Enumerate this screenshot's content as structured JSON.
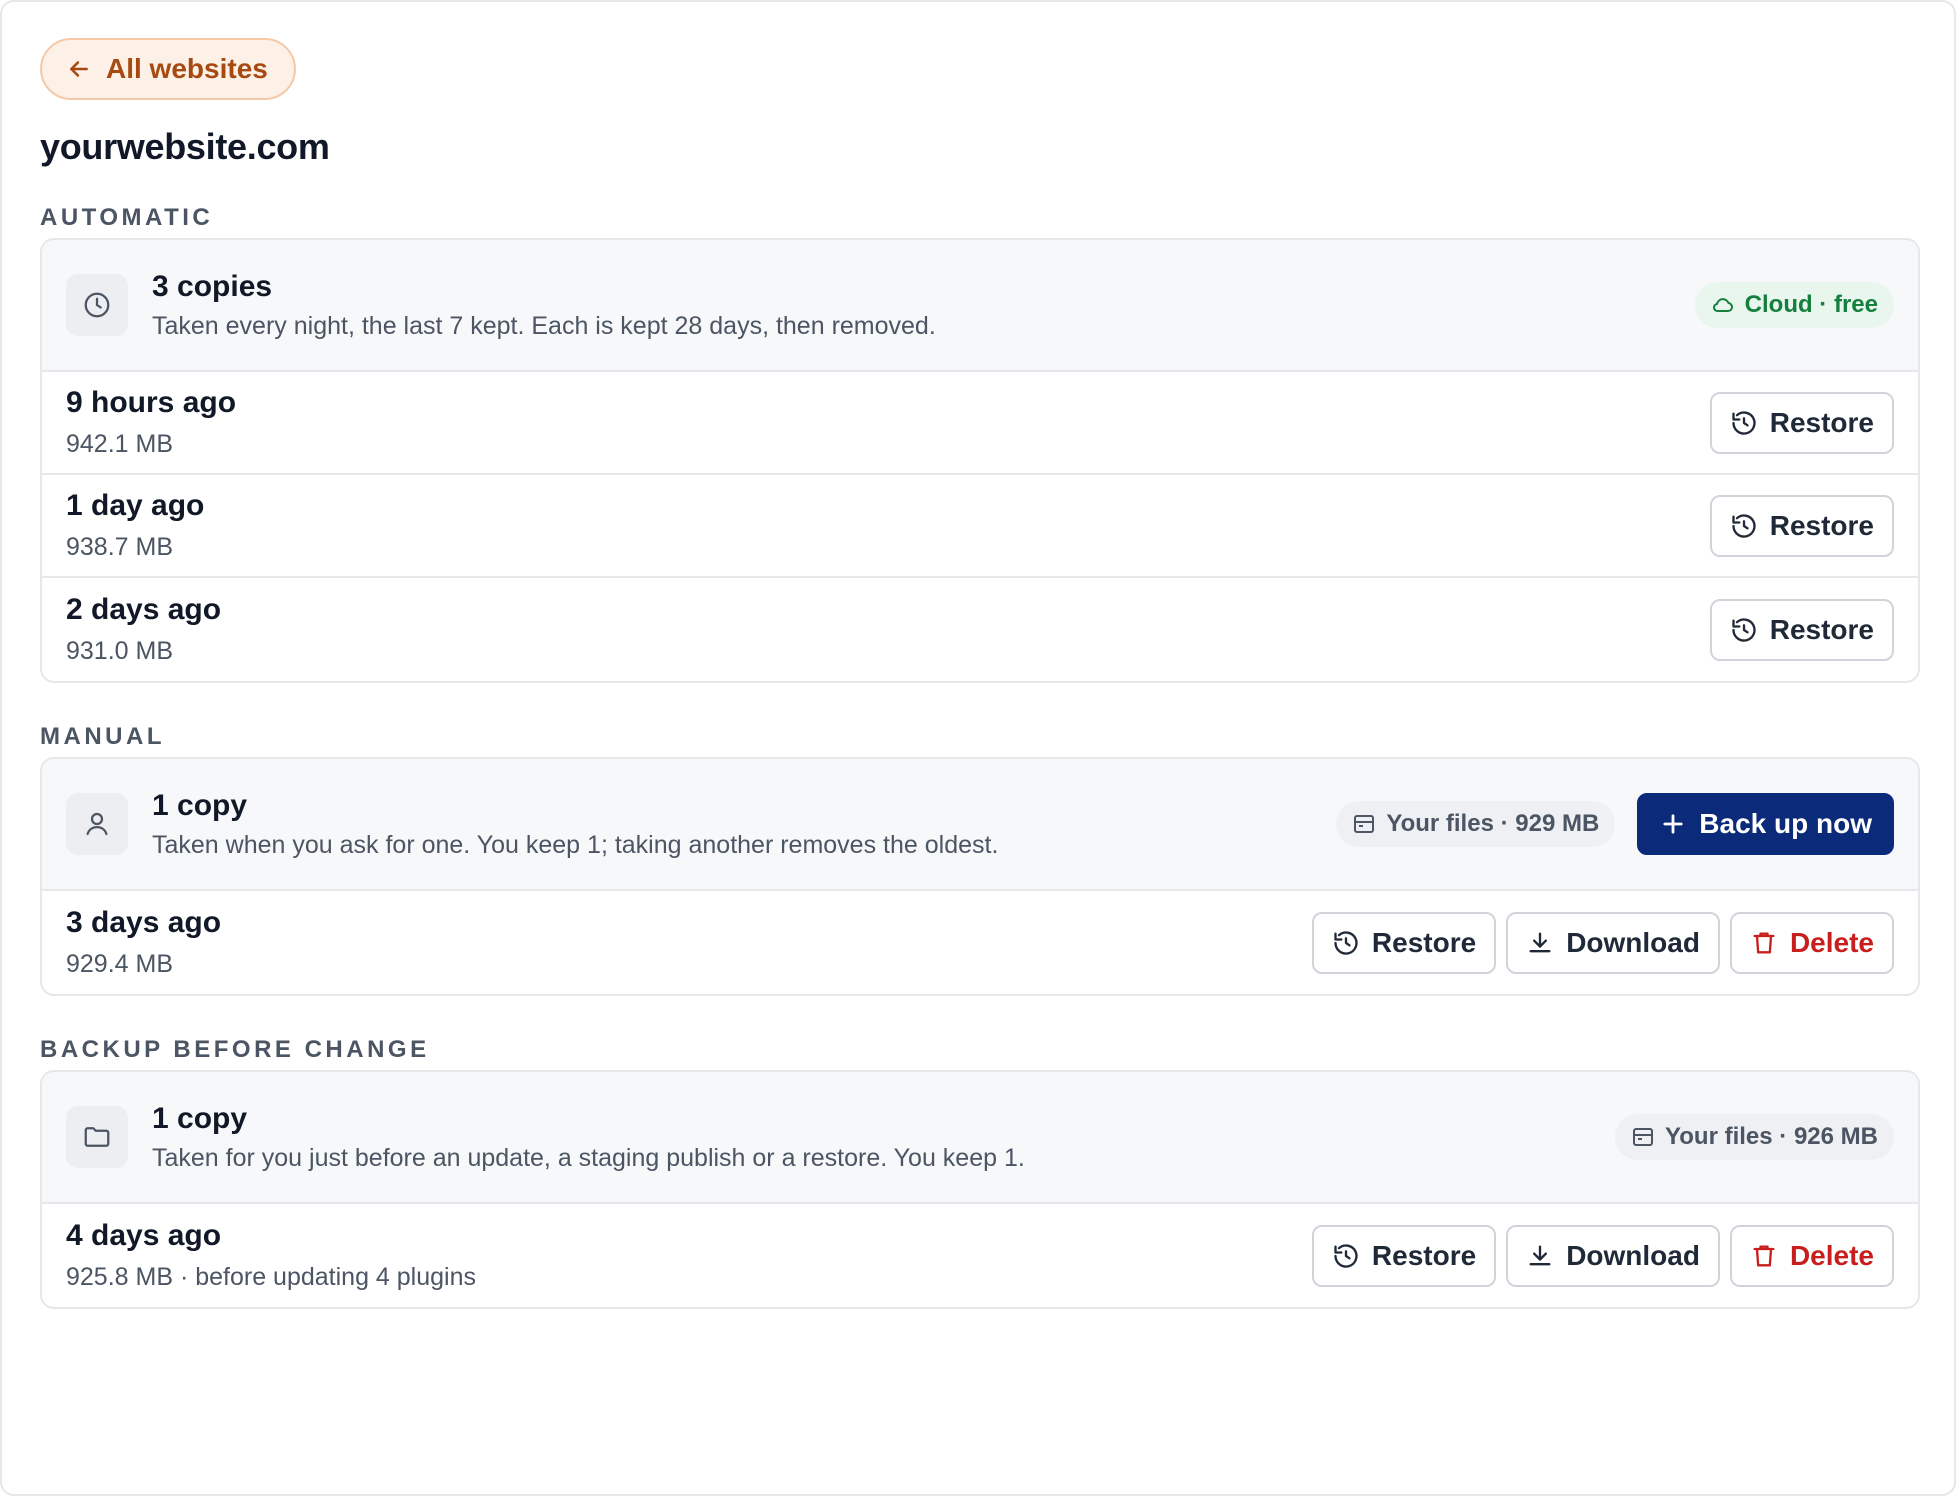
{
  "nav": {
    "back_label": "All websites"
  },
  "site": {
    "title": "yourwebsite.com"
  },
  "sections": {
    "automatic": {
      "label": "AUTOMATIC",
      "title": "3 copies",
      "description": "Taken every night, the last 7 kept. Each is kept 28 days, then removed.",
      "badge": "Cloud · free",
      "rows": [
        {
          "title": "9 hours ago",
          "sub": "942.1 MB",
          "restore": "Restore"
        },
        {
          "title": "1 day ago",
          "sub": "938.7 MB",
          "restore": "Restore"
        },
        {
          "title": "2 days ago",
          "sub": "931.0 MB",
          "restore": "Restore"
        }
      ]
    },
    "manual": {
      "label": "MANUAL",
      "title": "1 copy",
      "description": "Taken when you ask for one. You keep 1; taking another removes the oldest.",
      "badge": "Your files · 929 MB",
      "action": "Back up now",
      "rows": [
        {
          "title": "3 days ago",
          "sub": "929.4 MB",
          "restore": "Restore",
          "download": "Download",
          "delete": "Delete"
        }
      ]
    },
    "before_change": {
      "label": "BACKUP BEFORE CHANGE",
      "title": "1 copy",
      "description": "Taken for you just before an update, a staging publish or a restore. You keep 1.",
      "badge": "Your files · 926 MB",
      "rows": [
        {
          "title": "4 days ago",
          "sub": "925.8 MB · before updating 4 plugins",
          "restore": "Restore",
          "download": "Download",
          "delete": "Delete"
        }
      ]
    }
  },
  "colors": {
    "accent_orange": "#a64a12",
    "primary_blue": "#0c2a7a",
    "success_green": "#15803d",
    "danger_red": "#c81e1e"
  },
  "icons": {
    "back": "arrow-left-icon",
    "automatic": "clock-icon",
    "manual": "user-icon",
    "before_change": "folder-icon",
    "cloud": "cloud-icon",
    "files": "storage-icon",
    "restore": "history-icon",
    "download": "download-icon",
    "delete": "trash-icon",
    "add": "plus-icon"
  }
}
